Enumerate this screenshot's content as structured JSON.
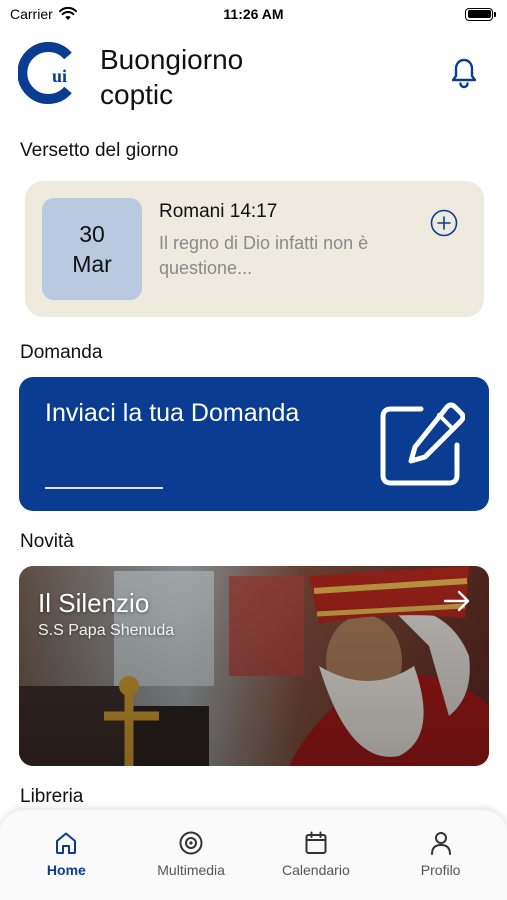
{
  "status": {
    "carrier": "Carrier",
    "time": "11:26 AM"
  },
  "header": {
    "greeting": "Buongiorno coptic",
    "logo_text": "ui"
  },
  "verse_section": {
    "title": "Versetto del giorno",
    "day": "30",
    "month": "Mar",
    "reference": "Romani 14:17",
    "excerpt": "Il regno di Dio infatti non è questione..."
  },
  "question_section": {
    "title": "Domanda",
    "card_text": "Inviaci la tua Domanda"
  },
  "news_section": {
    "title": "Novità",
    "item_title": "Il Silenzio",
    "item_subtitle": "S.S Papa Shenuda"
  },
  "library_section": {
    "title": "Libreria"
  },
  "tabs": [
    {
      "label": "Home",
      "icon": "home-icon",
      "active": true
    },
    {
      "label": "Multimedia",
      "icon": "multimedia-icon",
      "active": false
    },
    {
      "label": "Calendario",
      "icon": "calendar-icon",
      "active": false
    },
    {
      "label": "Profilo",
      "icon": "profile-icon",
      "active": false
    }
  ],
  "colors": {
    "primary": "#0a3d91",
    "verse_card_bg": "#efeade",
    "date_box_bg": "#b8c9e0"
  }
}
